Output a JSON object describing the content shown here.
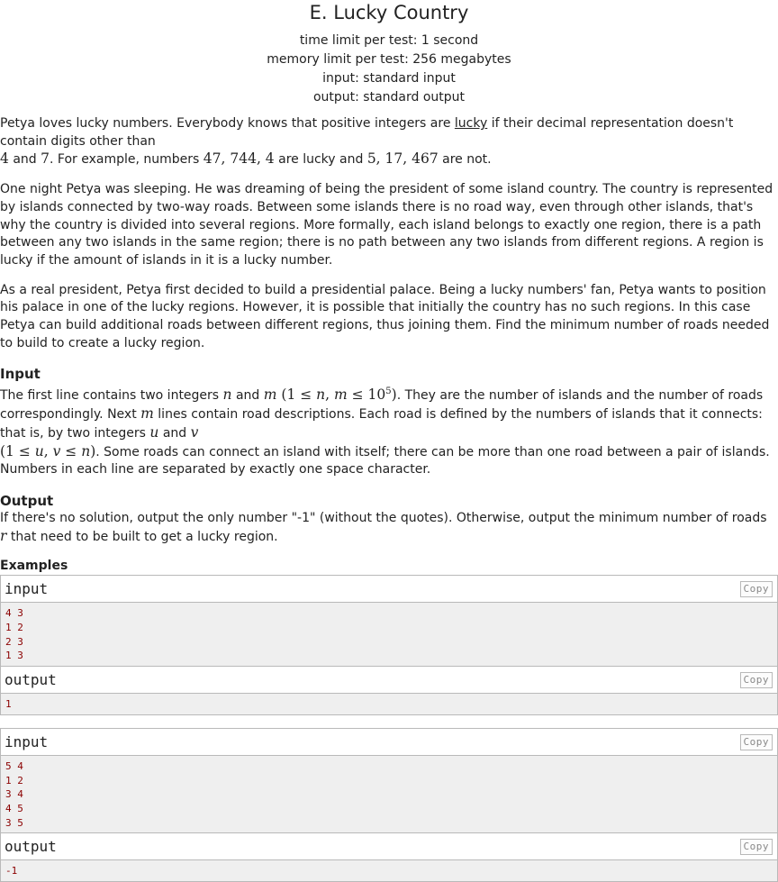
{
  "problem": {
    "title": "E. Lucky Country",
    "time_limit": "time limit per test: 1 second",
    "memory_limit": "memory limit per test: 256 megabytes",
    "input_spec": "input: standard input",
    "output_spec": "output: standard output"
  },
  "legend": {
    "p1_a": "Petya loves lucky numbers. Everybody knows that positive integers are ",
    "p1_lucky": "lucky",
    "p1_b": " if their decimal representation doesn't contain digits other than",
    "p1_4": "4",
    "p1_and": " and ",
    "p1_7": "7",
    "p1_c": ". For example, numbers ",
    "p1_lucky_nums": "47, 744, 4",
    "p1_d": " are lucky and ",
    "p1_unlucky_nums": "5, 17, 467",
    "p1_e": " are not.",
    "p2": "One night Petya was sleeping. He was dreaming of being the president of some island country. The country is represented by islands connected by two-way roads. Between some islands there is no road way, even through other islands, that's why the country is divided into several regions. More formally, each island belongs to exactly one region, there is a path between any two islands in the same region; there is no path between any two islands from different regions. A region is lucky if the amount of islands in it is a lucky number.",
    "p3": "As a real president, Petya first decided to build a presidential palace. Being a lucky numbers' fan, Petya wants to position his palace in one of the lucky regions. However, it is possible that initially the country has no such regions. In this case Petya can build additional roads between different regions, thus joining them. Find the minimum number of roads needed to build to create a lucky region."
  },
  "input_section": {
    "title": "Input",
    "a": "The first line contains two integers ",
    "n": "n",
    "and": " and ",
    "m": "m",
    "paren_open": " (1 ≤ ",
    "comma": ", ",
    "leq": " ≤ 10",
    "exp": "5",
    "paren_close": ")",
    "b": ". They are the number of islands and the number of roads correspondingly. Next ",
    "c": " lines contain road descriptions. Each road is defined by the numbers of islands that it connects: that is, by two integers ",
    "u": "u",
    "v": "v",
    "d_open": "(1 ≤ ",
    "le": " ≤ ",
    "e": ". Some roads can connect an island with itself; there can be more than one road between a pair of islands. Numbers in each line are separated by exactly one space character."
  },
  "output_section": {
    "title": "Output",
    "a": "If there's no solution, output the only number \"-1\" (without the quotes). Otherwise, output the minimum number of roads ",
    "r": "r",
    "b": " that need to be built to get a lucky region."
  },
  "examples": {
    "title": "Examples",
    "input_label": "input",
    "output_label": "output",
    "copy_label": "Copy",
    "ex1_input": "4 3\n1 2\n2 3\n1 3",
    "ex1_output": "1",
    "ex2_input": "5 4\n1 2\n3 4\n4 5\n3 5",
    "ex2_output": "-1"
  }
}
